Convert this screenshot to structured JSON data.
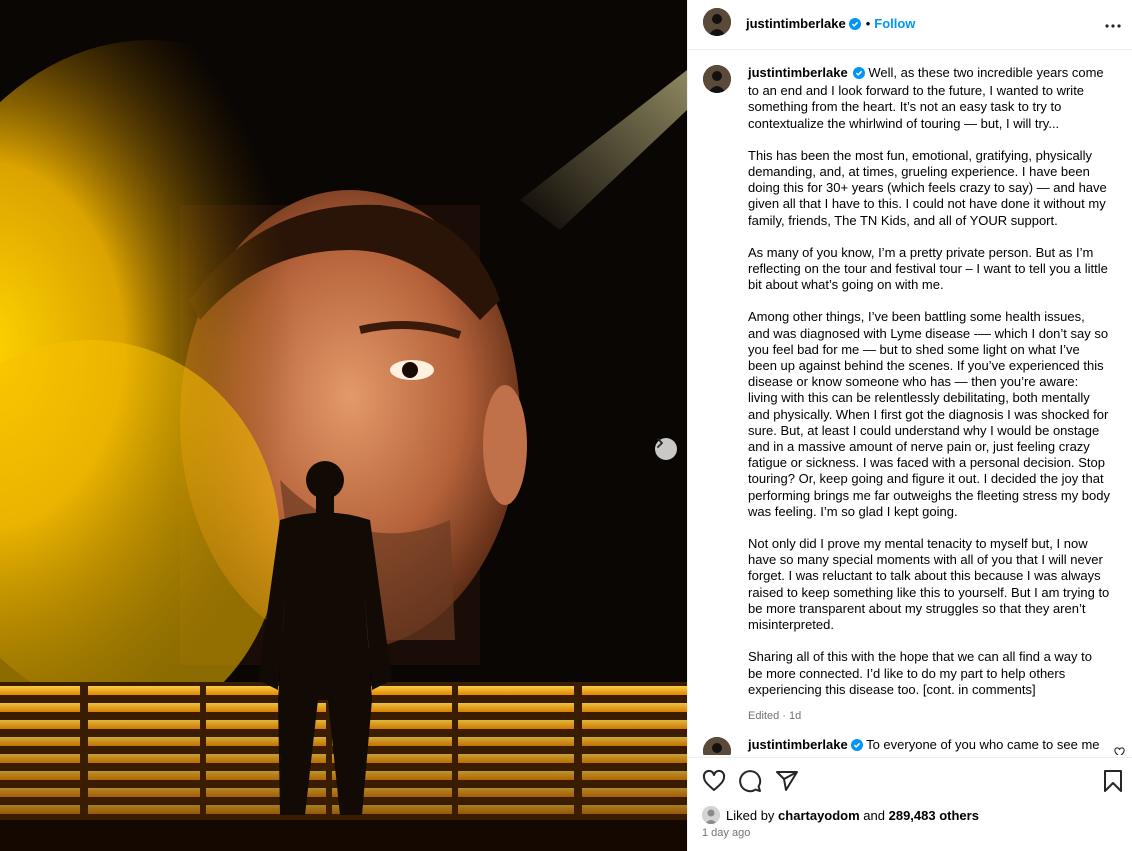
{
  "post": {
    "username": "justintimberlake",
    "follow_label": "Follow",
    "separator": "•"
  },
  "caption": {
    "username": "justintimberlake",
    "paragraphs": [
      "Well, as these two incredible years come to an end and I look forward to the future, I wanted to write something from the heart. It’s not an easy task to try to contextualize the whirlwind of touring — but, I will try...",
      "This has been the most fun, emotional, gratifying, physically demanding, and, at times, grueling experience. I have been doing this for 30+ years (which feels crazy to say) — and have given all that I have to this. I could not have done it without my family, friends, The TN Kids, and all of YOUR support.",
      "As many of you know, I’m a pretty private person. But as I’m reflecting on the tour and festival tour – I want to tell you a little bit about what’s going on with me.",
      "Among other things, I’ve been battling some health issues, and was diagnosed with Lyme disease -— which I don’t say so you feel bad for me — but to shed some light on what I’ve been up against behind the scenes. If you’ve experienced this disease or know someone who has — then you’re aware: living with this can be relentlessly debilitating, both mentally and physically. When I first got the diagnosis I was shocked for sure. But, at least I could understand why I would be onstage and in a massive amount of nerve pain or, just feeling crazy fatigue or sickness. I was faced with a personal decision. Stop touring? Or, keep going and figure it out. I decided the joy that performing brings me far outweighs the fleeting stress my body was feeling. I’m so glad I kept going.",
      "Not only did I prove my mental tenacity to myself but, I now have so many special moments with all of you that I will never forget. I was reluctant to talk about this because I was always raised to keep something like this to yourself. But I am trying to be more transparent about my struggles so that they aren’t misinterpreted.",
      "Sharing all of this with the hope that we can all find a way to be more connected. I’d like to do my part to help others experiencing this disease too. [cont. in comments]"
    ],
    "meta": "Edited · 1d"
  },
  "reply": {
    "username": "justintimberlake",
    "text": "To everyone of you who came to see me"
  },
  "likes": {
    "prefix": "Liked by ",
    "user": "chartayodom",
    "middle": " and ",
    "count": "289,483 others"
  },
  "timestamp": "1 day ago",
  "icons": {
    "verified": "verified-badge-icon",
    "more": "more-options-icon",
    "next": "chevron-right-icon",
    "like": "heart-icon",
    "comment": "comment-icon",
    "share": "paper-plane-icon",
    "save": "bookmark-icon"
  },
  "colors": {
    "link": "#0095f6",
    "verified": "#0095f6",
    "muted": "#737373",
    "stage_glow": "#f5b800"
  }
}
